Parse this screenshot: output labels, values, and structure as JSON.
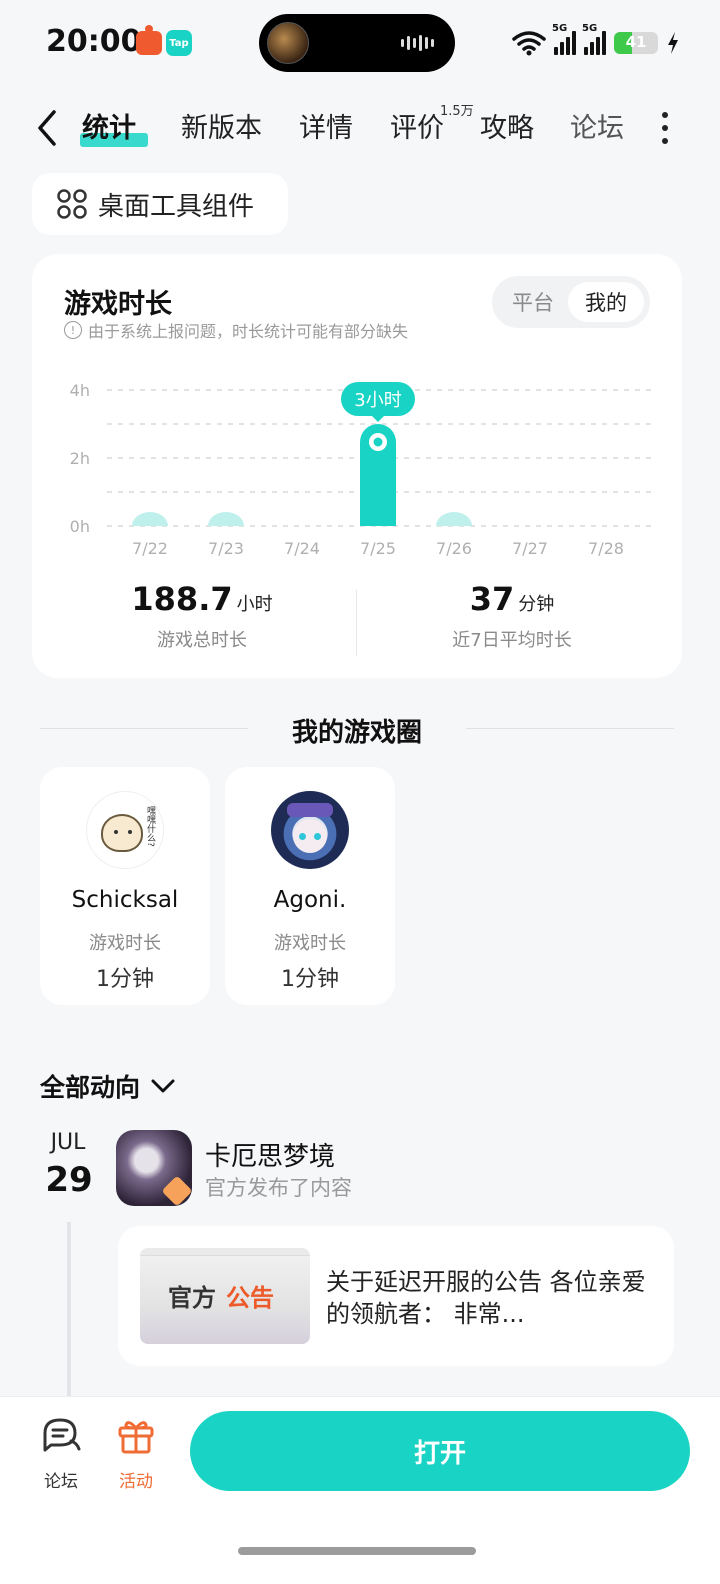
{
  "status_bar": {
    "time": "20:00",
    "app_icon_tap": "Tap",
    "signal_1": "5G",
    "signal_2": "5G",
    "battery": "41"
  },
  "nav": {
    "tabs": [
      "统计",
      "新版本",
      "详情",
      "评价",
      "攻略",
      "论坛"
    ],
    "review_count_badge": "1.5万"
  },
  "widget_chip": {
    "label": "桌面工具组件"
  },
  "stats_card": {
    "title": "游戏时长",
    "note": "由于系统上报问题，时长统计可能有部分缺失",
    "toggle": {
      "options": [
        "平台",
        "我的"
      ],
      "selected": "我的"
    },
    "total": {
      "value": "188.7",
      "unit": "小时",
      "caption": "游戏总时长"
    },
    "avg": {
      "value": "37",
      "unit": "分钟",
      "caption": "近7日平均时长"
    }
  },
  "chart_data": {
    "type": "bar",
    "categories": [
      "7/22",
      "7/23",
      "7/24",
      "7/25",
      "7/26",
      "7/27",
      "7/28"
    ],
    "values": [
      0.35,
      0.25,
      0,
      3,
      0.3,
      0,
      0
    ],
    "y_ticks": [
      "0h",
      "2h",
      "4h"
    ],
    "ylim": [
      0,
      4
    ],
    "highlight_index": 3,
    "highlight_label": "3小时",
    "grid": "dashed",
    "color": "#19d4c5",
    "faint_color": "#bff0ec"
  },
  "game_circle": {
    "title": "我的游戏圈",
    "friends": [
      {
        "name": "Schicksal",
        "label": "游戏时长",
        "value": "1分钟"
      },
      {
        "name": "Agoni.",
        "label": "游戏时长",
        "value": "1分钟"
      }
    ],
    "avatar_text": "嘿嘿什么?"
  },
  "feed": {
    "header": "全部动向",
    "month": "JUL",
    "day": "29",
    "game_name": "卡厄思梦境",
    "game_sub": "官方发布了内容",
    "post_text": "关于延迟开服的公告 各位亲爱的领航者： 非常...",
    "thumb_text_1": "官方",
    "thumb_text_2": "公告"
  },
  "bottom_bar": {
    "forum_label": "论坛",
    "activity_label": "活动",
    "open_label": "打开",
    "accent": "#19d4c5",
    "activity_color": "#ef6c35"
  }
}
